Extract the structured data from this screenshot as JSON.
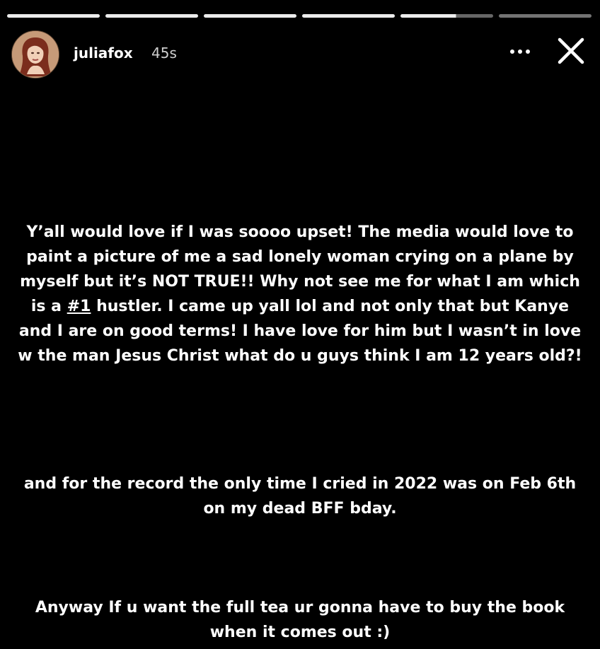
{
  "story": {
    "progress_segments": [
      {
        "state": "done"
      },
      {
        "state": "done"
      },
      {
        "state": "done"
      },
      {
        "state": "done"
      },
      {
        "state": "active"
      },
      {
        "state": "upcoming"
      }
    ],
    "username": "juliafox",
    "timestamp": "45s",
    "paragraphs": [
      {
        "before": "Y’all would love if I was soooo upset! The media would love to paint a picture of me a sad lonely woman crying on a plane by myself but it’s NOT TRUE!! Why not see me for what I am which is a ",
        "highlight": "#1",
        "after": " hustler. I came up yall lol and not only that but Kanye and I are on good terms! I have love for him but I wasn’t in love w the man Jesus Christ what do u guys think I am 12 years old?!"
      },
      {
        "text": "and for the record the only time I cried in 2022 was on Feb 6th on my dead BFF bday."
      },
      {
        "text": "Anyway If u want the full tea ur gonna have to buy the book when it comes out :)"
      }
    ]
  },
  "icons": {
    "more": "more-options-icon",
    "close": "close-icon",
    "avatar": "profile-avatar"
  },
  "colors": {
    "background": "#000000",
    "text": "#ffffff",
    "timestamp": "#cfcfcf"
  }
}
